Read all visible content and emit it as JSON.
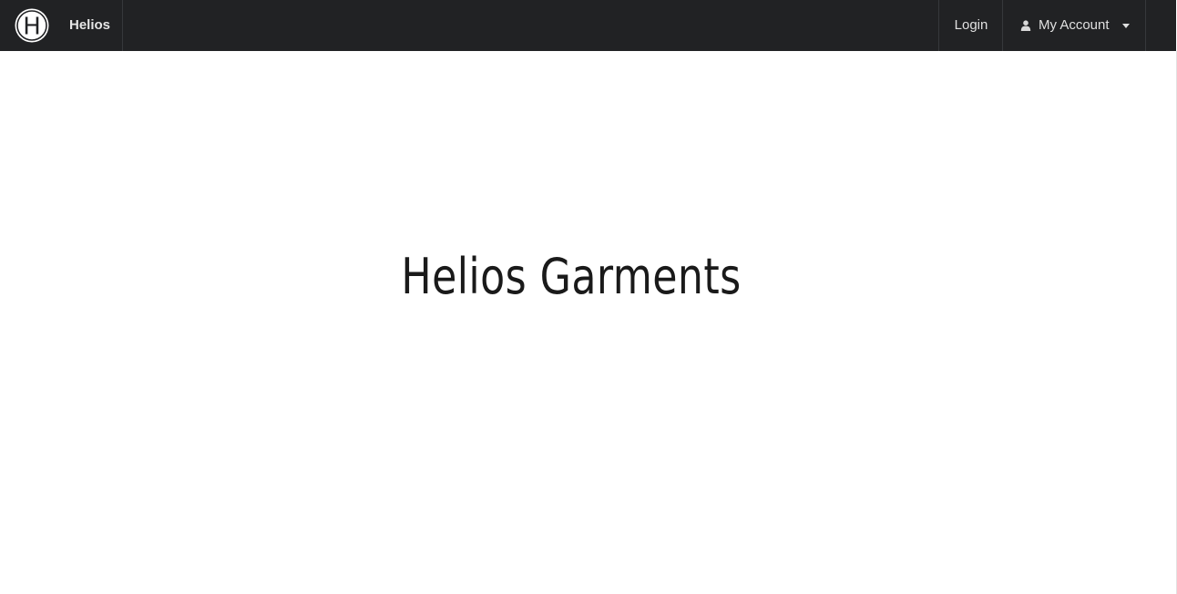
{
  "navbar": {
    "brand_label": "Helios",
    "logo_letter": "H",
    "login_label": "Login",
    "account_label": "My Account",
    "colors": {
      "background": "#212224",
      "text": "#e0e0e0"
    }
  },
  "hero": {
    "title": "Helios Garments"
  },
  "icons": {
    "logo": "helios-logo-icon",
    "user": "user-icon",
    "caret": "caret-down-icon"
  }
}
